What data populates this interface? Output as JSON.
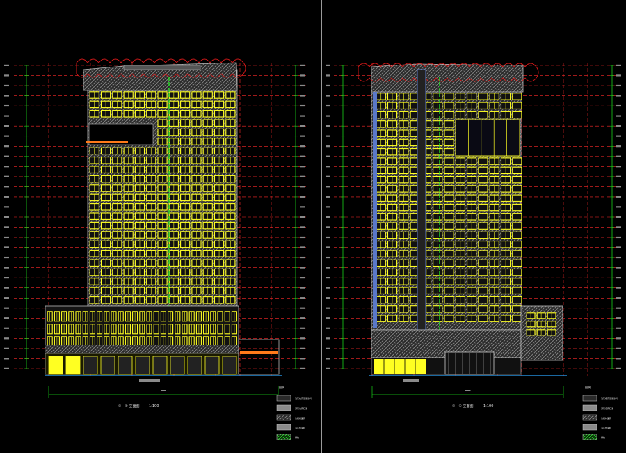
{
  "colors": {
    "background": "#000000",
    "divider": "#9a9a9a",
    "grid_red": "#ff2a2a",
    "grid_green": "#19d219",
    "window_yellow": "#ffff22",
    "hatch_gray": "#9a9a9a",
    "accent_green": "#26e026",
    "cloud_red": "#d01818",
    "glass_blue": "#5a78c8",
    "orange": "#ff7a1a",
    "ground_cyan": "#2aa6ff",
    "label_white": "#e6e6e6"
  },
  "drawings": [
    {
      "title": "① - ⑦ 立面图",
      "scale": "1:100",
      "legend": {
        "heading": "图例",
        "items": [
          {
            "swatch": "plain",
            "label": "浅灰色真石漆涂料"
          },
          {
            "swatch": "gray",
            "label": "深灰色真石漆"
          },
          {
            "swatch": "hatch",
            "label": "仿石材面砖"
          },
          {
            "swatch": "gray",
            "label": "深灰色涂料"
          },
          {
            "swatch": "green",
            "label": "绿化"
          }
        ]
      }
    },
    {
      "title": "⑦ - ① 立面图",
      "scale": "1:100",
      "legend": {
        "heading": "图例",
        "items": [
          {
            "swatch": "plain",
            "label": "浅灰色真石漆涂料"
          },
          {
            "swatch": "gray",
            "label": "深灰色真石漆"
          },
          {
            "swatch": "hatch",
            "label": "仿石材面砖"
          },
          {
            "swatch": "gray",
            "label": "深灰色涂料"
          },
          {
            "swatch": "green",
            "label": "绿化"
          }
        ]
      }
    }
  ]
}
